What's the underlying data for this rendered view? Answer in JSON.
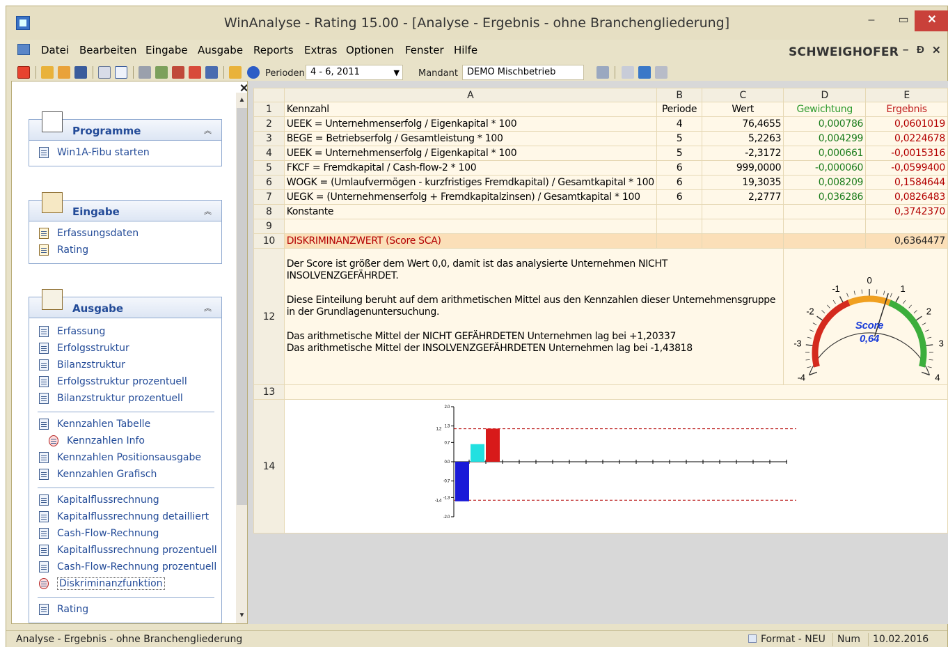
{
  "window": {
    "title": "WinAnalyse - Rating 15.00 - [Analyse - Ergebnis - ohne Branchengliederung]",
    "min_glyph": "–",
    "max_glyph": "▭",
    "close_glyph": "✕"
  },
  "menu": {
    "items": [
      {
        "label": "Datei"
      },
      {
        "label": "Bearbeiten"
      },
      {
        "label": "Eingabe"
      },
      {
        "label": "Ausgabe"
      },
      {
        "label": "Reports"
      },
      {
        "label": "Extras"
      },
      {
        "label": "Optionen"
      },
      {
        "label": "Fenster"
      },
      {
        "label": "Hilfe"
      }
    ],
    "brand": "SCHWEIGHOFER",
    "mdi_min": "–",
    "mdi_restore": "Ɖ",
    "mdi_close": "✕"
  },
  "toolbar": {
    "perioden_label": "Perioden",
    "perioden_value": "4 - 6,  2011",
    "mandant_label": "Mandant",
    "mandant_value": "DEMO Mischbetrieb"
  },
  "sidebar": {
    "close_glyph": "✕",
    "groups": {
      "programme": {
        "title": "Programme",
        "items": [
          {
            "label": "Win1A-Fibu starten"
          }
        ]
      },
      "eingabe": {
        "title": "Eingabe",
        "items": [
          {
            "label": "Erfassungsdaten"
          },
          {
            "label": "Rating"
          }
        ]
      },
      "ausgabe": {
        "title": "Ausgabe",
        "items": [
          {
            "label": "Erfassung"
          },
          {
            "label": "Erfolgsstruktur"
          },
          {
            "label": "Bilanzstruktur"
          },
          {
            "label": "Erfolgsstruktur prozentuell"
          },
          {
            "label": "Bilanzstruktur prozentuell"
          },
          {
            "label": "Kennzahlen Tabelle"
          },
          {
            "label": "Kennzahlen Info"
          },
          {
            "label": "Kennzahlen Positionsausgabe"
          },
          {
            "label": "Kennzahlen Grafisch"
          },
          {
            "label": "Kapitalflussrechnung"
          },
          {
            "label": "Kapitalflussrechnung detailliert"
          },
          {
            "label": "Cash-Flow-Rechnung"
          },
          {
            "label": "Kapitalflussrechnung prozentuell"
          },
          {
            "label": "Cash-Flow-Rechnung prozentuell"
          },
          {
            "label": "Diskriminanzfunktion"
          },
          {
            "label": "Rating"
          }
        ]
      }
    }
  },
  "grid": {
    "columns": [
      "A",
      "B",
      "C",
      "D",
      "E"
    ],
    "header": {
      "num": "1",
      "A": "Kennzahl",
      "B": "Periode",
      "C": "Wert",
      "D": "Gewichtung",
      "E": "Ergebnis"
    },
    "rows": [
      {
        "num": "2",
        "A": "UEEK = Unternehmenserfolg / Eigenkapital * 100",
        "B": "4",
        "C": "76,4655",
        "D": "0,000786",
        "E": "0,0601019"
      },
      {
        "num": "3",
        "A": "BEGE = Betriebserfolg / Gesamtleistung * 100",
        "B": "5",
        "C": "5,2263",
        "D": "0,004299",
        "E": "0,0224678"
      },
      {
        "num": "4",
        "A": "UEEK = Unternehmenserfolg / Eigenkapital * 100",
        "B": "5",
        "C": "-2,3172",
        "D": "0,000661",
        "E": "-0,0015316"
      },
      {
        "num": "5",
        "A": "FKCF = Fremdkapital / Cash-flow-2 * 100",
        "B": "6",
        "C": "999,0000",
        "D": "-0,000060",
        "E": "-0,0599400"
      },
      {
        "num": "6",
        "A": "WOGK = (Umlaufvermögen - kurzfristiges Fremdkapital) / Gesamtkapital * 100",
        "B": "6",
        "C": "19,3035",
        "D": "0,008209",
        "E": "0,1584644"
      },
      {
        "num": "7",
        "A": "UEGK = (Unternehmenserfolg + Fremdkapitalzinsen) / Gesamtkapital * 100",
        "B": "6",
        "C": "2,2777",
        "D": "0,036286",
        "E": "0,0826483"
      },
      {
        "num": "8",
        "A": "Konstante",
        "B": "",
        "C": "",
        "D": "",
        "E": "0,3742370"
      },
      {
        "num": "9",
        "A": "",
        "B": "",
        "C": "",
        "D": "",
        "E": ""
      }
    ],
    "score_row": {
      "num": "10",
      "A": "DISKRIMINANZWERT (Score SCA)",
      "E": "0,6364477"
    },
    "text_row": {
      "num": "12",
      "line1": "Der Score ist größer dem Wert 0,0, damit ist das analysierte Unternehmen NICHT INSOLVENZGEFÄHRDET.",
      "line2": "Diese Einteilung beruht auf dem arithmetischen Mittel aus den Kennzahlen dieser Unternehmensgruppe in der Grundlagenuntersuchung.",
      "line3": "Das arithmetische Mittel der NICHT GEFÄHRDETEN Unternehmen lag bei +1,20337",
      "line4": "Das arithmetische Mittel der INSOLVENZGEFÄHRDETEN Unternehmen lag bei -1,43818"
    },
    "row13_num": "13",
    "row14_num": "14"
  },
  "gauge": {
    "score_label": "Score",
    "score_value": "0,64",
    "value": 0.64,
    "ticks": [
      "-4",
      "-3",
      "-2",
      "-1",
      "0",
      "1",
      "2",
      "3",
      "4"
    ],
    "red": "#d42a1e",
    "green": "#3cae3c",
    "label_color": "#1a3dd8"
  },
  "chart_data": {
    "type": "bar",
    "ylim": [
      -2.0,
      2.0
    ],
    "ytick_labels": [
      "2.0",
      "1.3",
      "0.7",
      "0.0",
      "-0.7",
      "-1.3",
      "-2.0"
    ],
    "reference_lines": [
      {
        "value": 1.2,
        "label": "1,2"
      },
      {
        "value": -1.4,
        "label": "-1,4"
      }
    ],
    "bars": [
      {
        "value": -1.43818,
        "color": "#1a1ad8"
      },
      {
        "value": 0.64,
        "color": "#22e0e0"
      },
      {
        "value": 1.20337,
        "color": "#d81a1a"
      }
    ],
    "reference_color": "#b30000"
  },
  "status": {
    "left": "Analyse - Ergebnis - ohne Branchengliederung",
    "format": "Format - NEU",
    "num": "Num",
    "date": "10.02.2016"
  }
}
